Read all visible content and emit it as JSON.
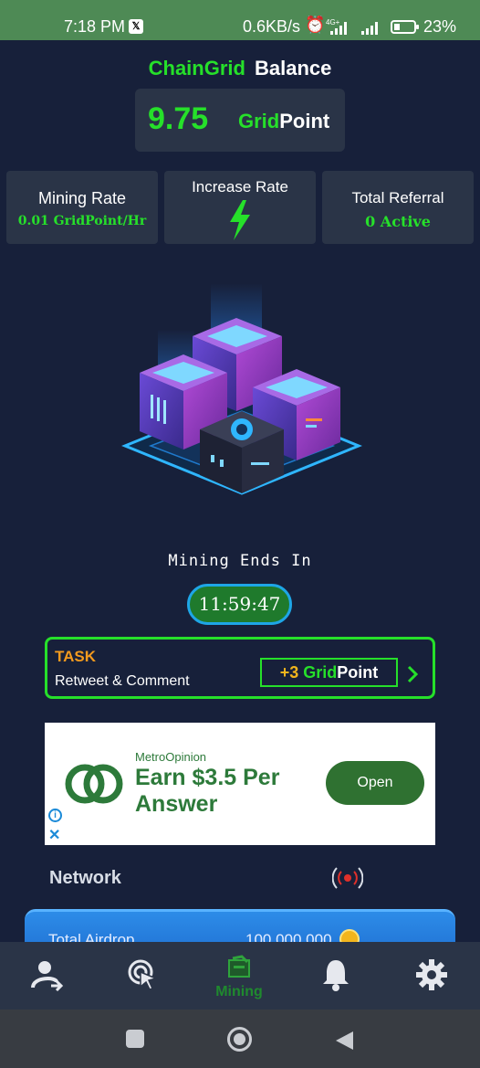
{
  "status_bar": {
    "time": "7:18 PM",
    "app_badge": "𝕏",
    "net_speed": "0.6KB/s",
    "network_type": "4G+",
    "battery": "23%"
  },
  "header": {
    "brand": "ChainGrid",
    "title": "Balance"
  },
  "balance": {
    "amount": "9.75",
    "unit_prefix": "Grid",
    "unit_suffix": "Point"
  },
  "stats": {
    "mining_rate": {
      "label": "Mining Rate",
      "value": "0.01 GridPoint/Hr"
    },
    "increase_rate": {
      "label": "Increase Rate",
      "icon": "lightning-bolt-icon"
    },
    "total_referral": {
      "label": "Total Referral",
      "value": "0 Active"
    }
  },
  "mining": {
    "ends_label": "Mining Ends In",
    "timer": "11:59:47"
  },
  "task": {
    "title": "TASK",
    "description": "Retweet & Comment",
    "reward_amount": "+3",
    "reward_unit_prefix": "Grid",
    "reward_unit_suffix": "Point"
  },
  "ad": {
    "advertiser": "MetroOpinion",
    "headline": "Earn $3.5 Per Answer",
    "cta": "Open"
  },
  "network": {
    "label": "Network"
  },
  "airdrop": {
    "label": "Total Airdrop",
    "value": "100,000,000"
  },
  "nav": {
    "items": [
      {
        "name": "referral",
        "icon": "user-share-icon"
      },
      {
        "name": "tap",
        "icon": "cursor-click-icon"
      },
      {
        "name": "mining",
        "icon": "mining-icon",
        "label": "Mining",
        "active": true
      },
      {
        "name": "notifications",
        "icon": "bell-icon"
      },
      {
        "name": "settings",
        "icon": "gear-icon"
      }
    ]
  },
  "colors": {
    "background": "#17203a",
    "accent_green": "#26e02a",
    "card": "#2a3447",
    "task_orange": "#f39a1e",
    "timer_border": "#1ea6e6",
    "status_bar": "#4e8a55"
  }
}
